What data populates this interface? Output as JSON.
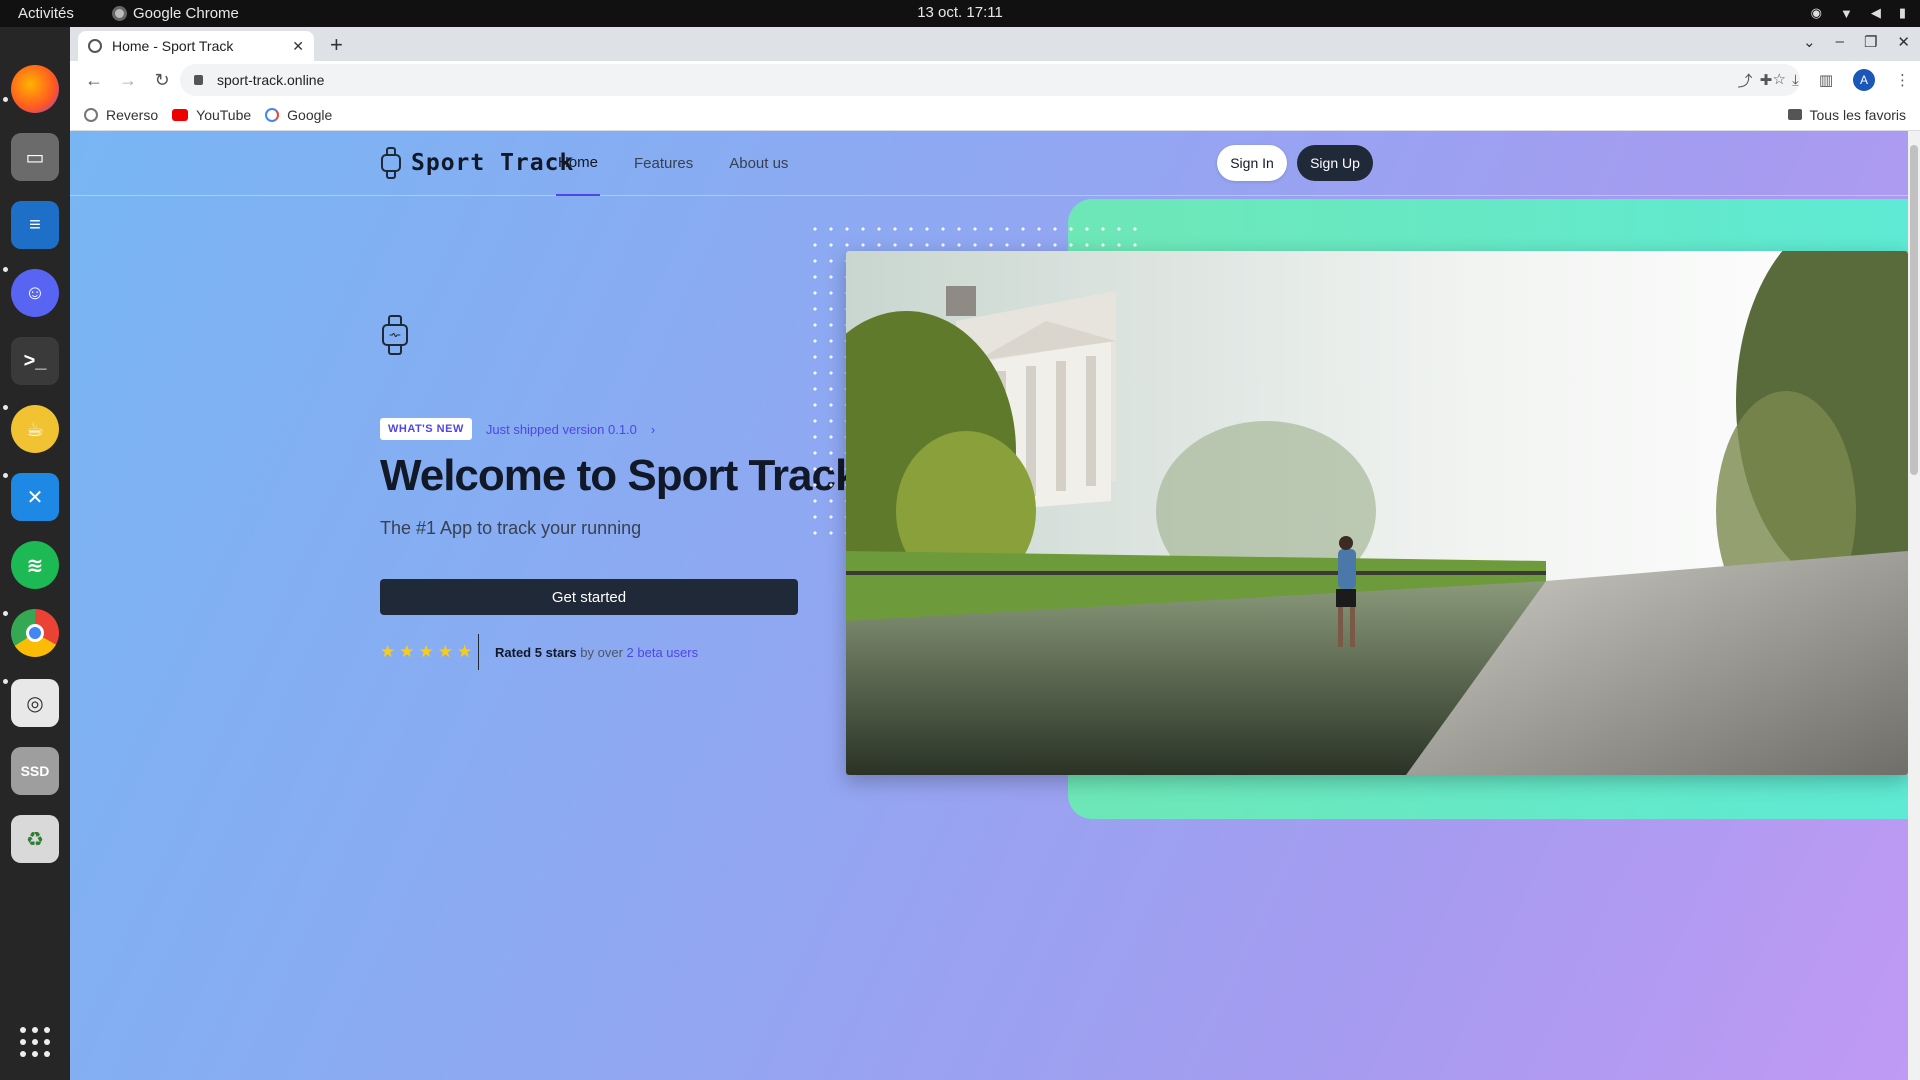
{
  "desktop": {
    "activities": "Activités",
    "app_name": "Google Chrome",
    "clock": "13 oct.  17:11",
    "tray_icons": [
      "discord-tray-icon",
      "wifi-icon",
      "volume-icon",
      "battery-icon"
    ]
  },
  "dock": {
    "apps": [
      "firefox",
      "files",
      "libreoffice-writer",
      "discord",
      "terminal",
      "teapot-app",
      "vscode",
      "spotify",
      "chrome",
      "document-viewer",
      "ssd-drive",
      "trash"
    ],
    "ssd_label": "SSD"
  },
  "browser": {
    "tab_title": "Home - Sport Track",
    "url": "sport-track.online",
    "bookmarks": [
      "Reverso",
      "YouTube",
      "Google"
    ],
    "all_bookmarks": "Tous les favoris",
    "profile_initial": "A"
  },
  "site": {
    "brand": "Sport Track",
    "nav": [
      "Home",
      "Features",
      "About us"
    ],
    "active_nav": "Home",
    "sign_in": "Sign In",
    "sign_up": "Sign Up",
    "badge": "WHAT'S NEW",
    "shipped": "Just shipped version 0.1.0",
    "headline": "Welcome to Sport Track",
    "subheadline": "The #1 App to track your running",
    "cta": "Get started",
    "rating": {
      "stars": 5,
      "rated": "Rated 5 stars",
      "by_over": "by over",
      "users": "2 beta users"
    },
    "colors": {
      "accent": "#4f46e5",
      "dark": "#1f2937",
      "teal": "#6ee7b7",
      "star": "#facc15"
    }
  }
}
